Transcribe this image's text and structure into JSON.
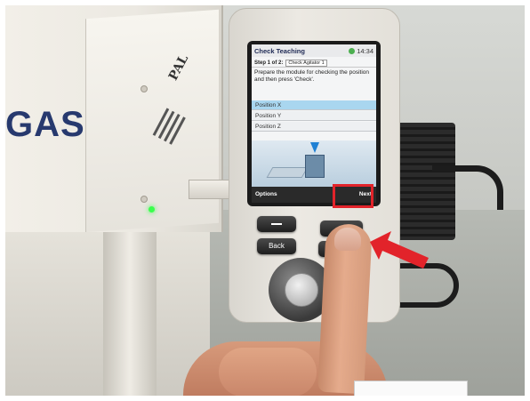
{
  "photo": {
    "housing_brand_text": "GAS",
    "housing_logo_text": "PAL",
    "terminal": {
      "screen": {
        "title": "Check Teaching",
        "time": "14:34",
        "step_label": "Step 1 of 2:",
        "step_selection": "Check Agitator 1",
        "message": "Prepare the module for checking the position and then press 'Check'.",
        "rows": [
          {
            "label": "Position X",
            "selected": true
          },
          {
            "label": "Position Y",
            "selected": false
          },
          {
            "label": "Position Z",
            "selected": false
          }
        ],
        "footer_left": "Options",
        "footer_right": "Next"
      },
      "buttons": {
        "back_label": "Back"
      }
    },
    "colors": {
      "highlight_box": "#e2232a",
      "arrow": "#e2232a",
      "led": "#3bff4d",
      "selected_row": "#a9d6ef"
    }
  }
}
